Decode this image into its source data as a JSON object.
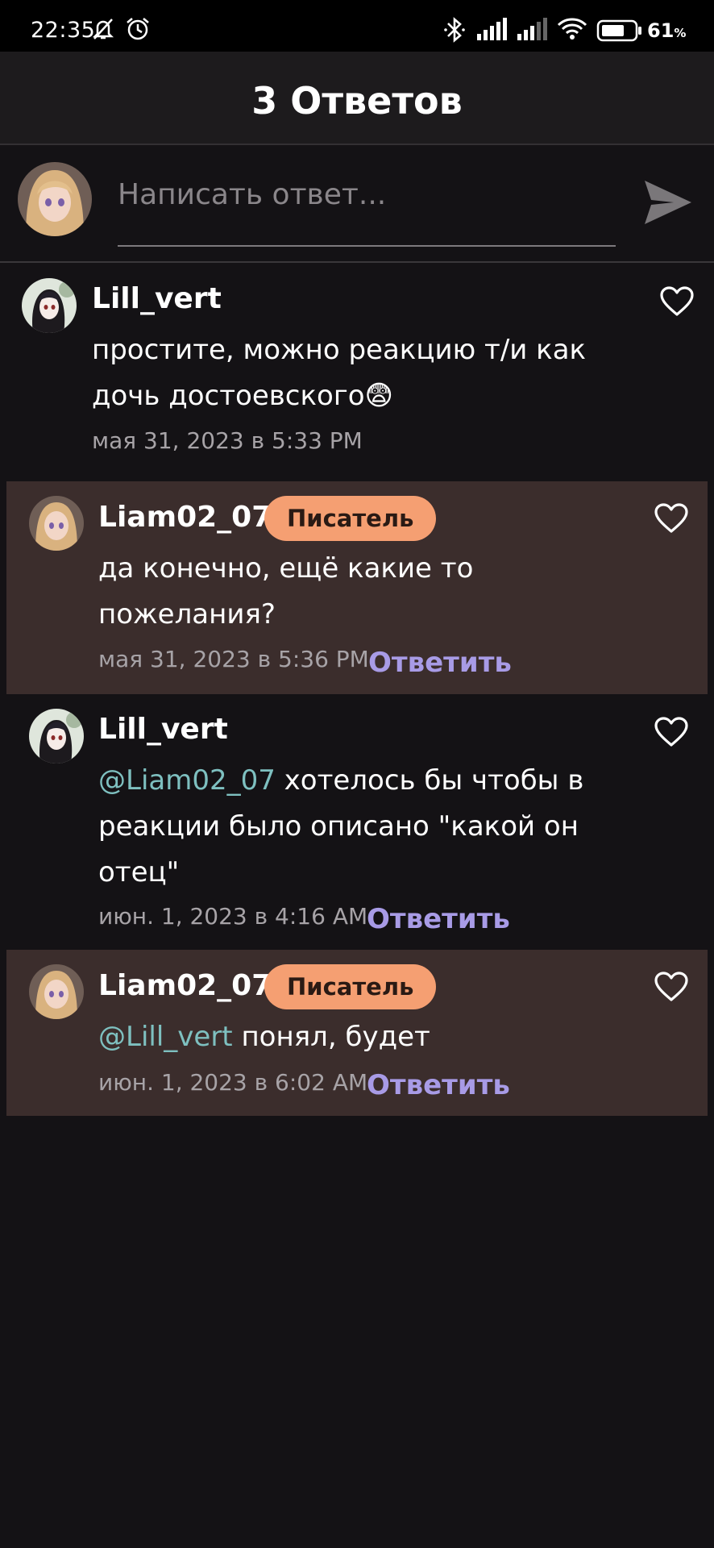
{
  "status_bar": {
    "time": "22:35",
    "battery_percent": "61",
    "battery_unit": "%"
  },
  "header": {
    "title": "3 Ответов"
  },
  "composer": {
    "placeholder": "Написать ответ..."
  },
  "comments": [
    {
      "author": "Lill_vert",
      "lines": [
        "простите, можно реакцию т/и как",
        "дочь достоевского😨"
      ],
      "timestamp": "мая 31, 2023 в 5:33 PM"
    },
    {
      "author": "Liam02_07",
      "badge": "Писатель",
      "lines": [
        "да конечно, ещё какие то",
        "пожелания?"
      ],
      "timestamp": "мая 31, 2023 в 5:36 PM",
      "reply_label": "Ответить"
    },
    {
      "author": "Lill_vert",
      "mention": "@Liam02_07",
      "lines": [
        " хотелось бы чтобы в",
        "реакции было описано \"какой он",
        "отец\""
      ],
      "timestamp": "июн. 1, 2023 в 4:16 AM",
      "reply_label": "Ответить"
    },
    {
      "author": "Liam02_07",
      "badge": "Писатель",
      "mention": "@Lill_vert",
      "lines": [
        " понял, будет"
      ],
      "timestamp": "июн. 1, 2023 в 6:02 AM",
      "reply_label": "Ответить"
    }
  ],
  "icons": {
    "like": "heart-outline-icon",
    "send": "send-arrow-icon"
  },
  "colors": {
    "background": "#141215",
    "author_highlight": "#3b2d2c",
    "badge": "#f59f72",
    "reply_link": "#a89be6",
    "mention": "#7ec0c0"
  }
}
